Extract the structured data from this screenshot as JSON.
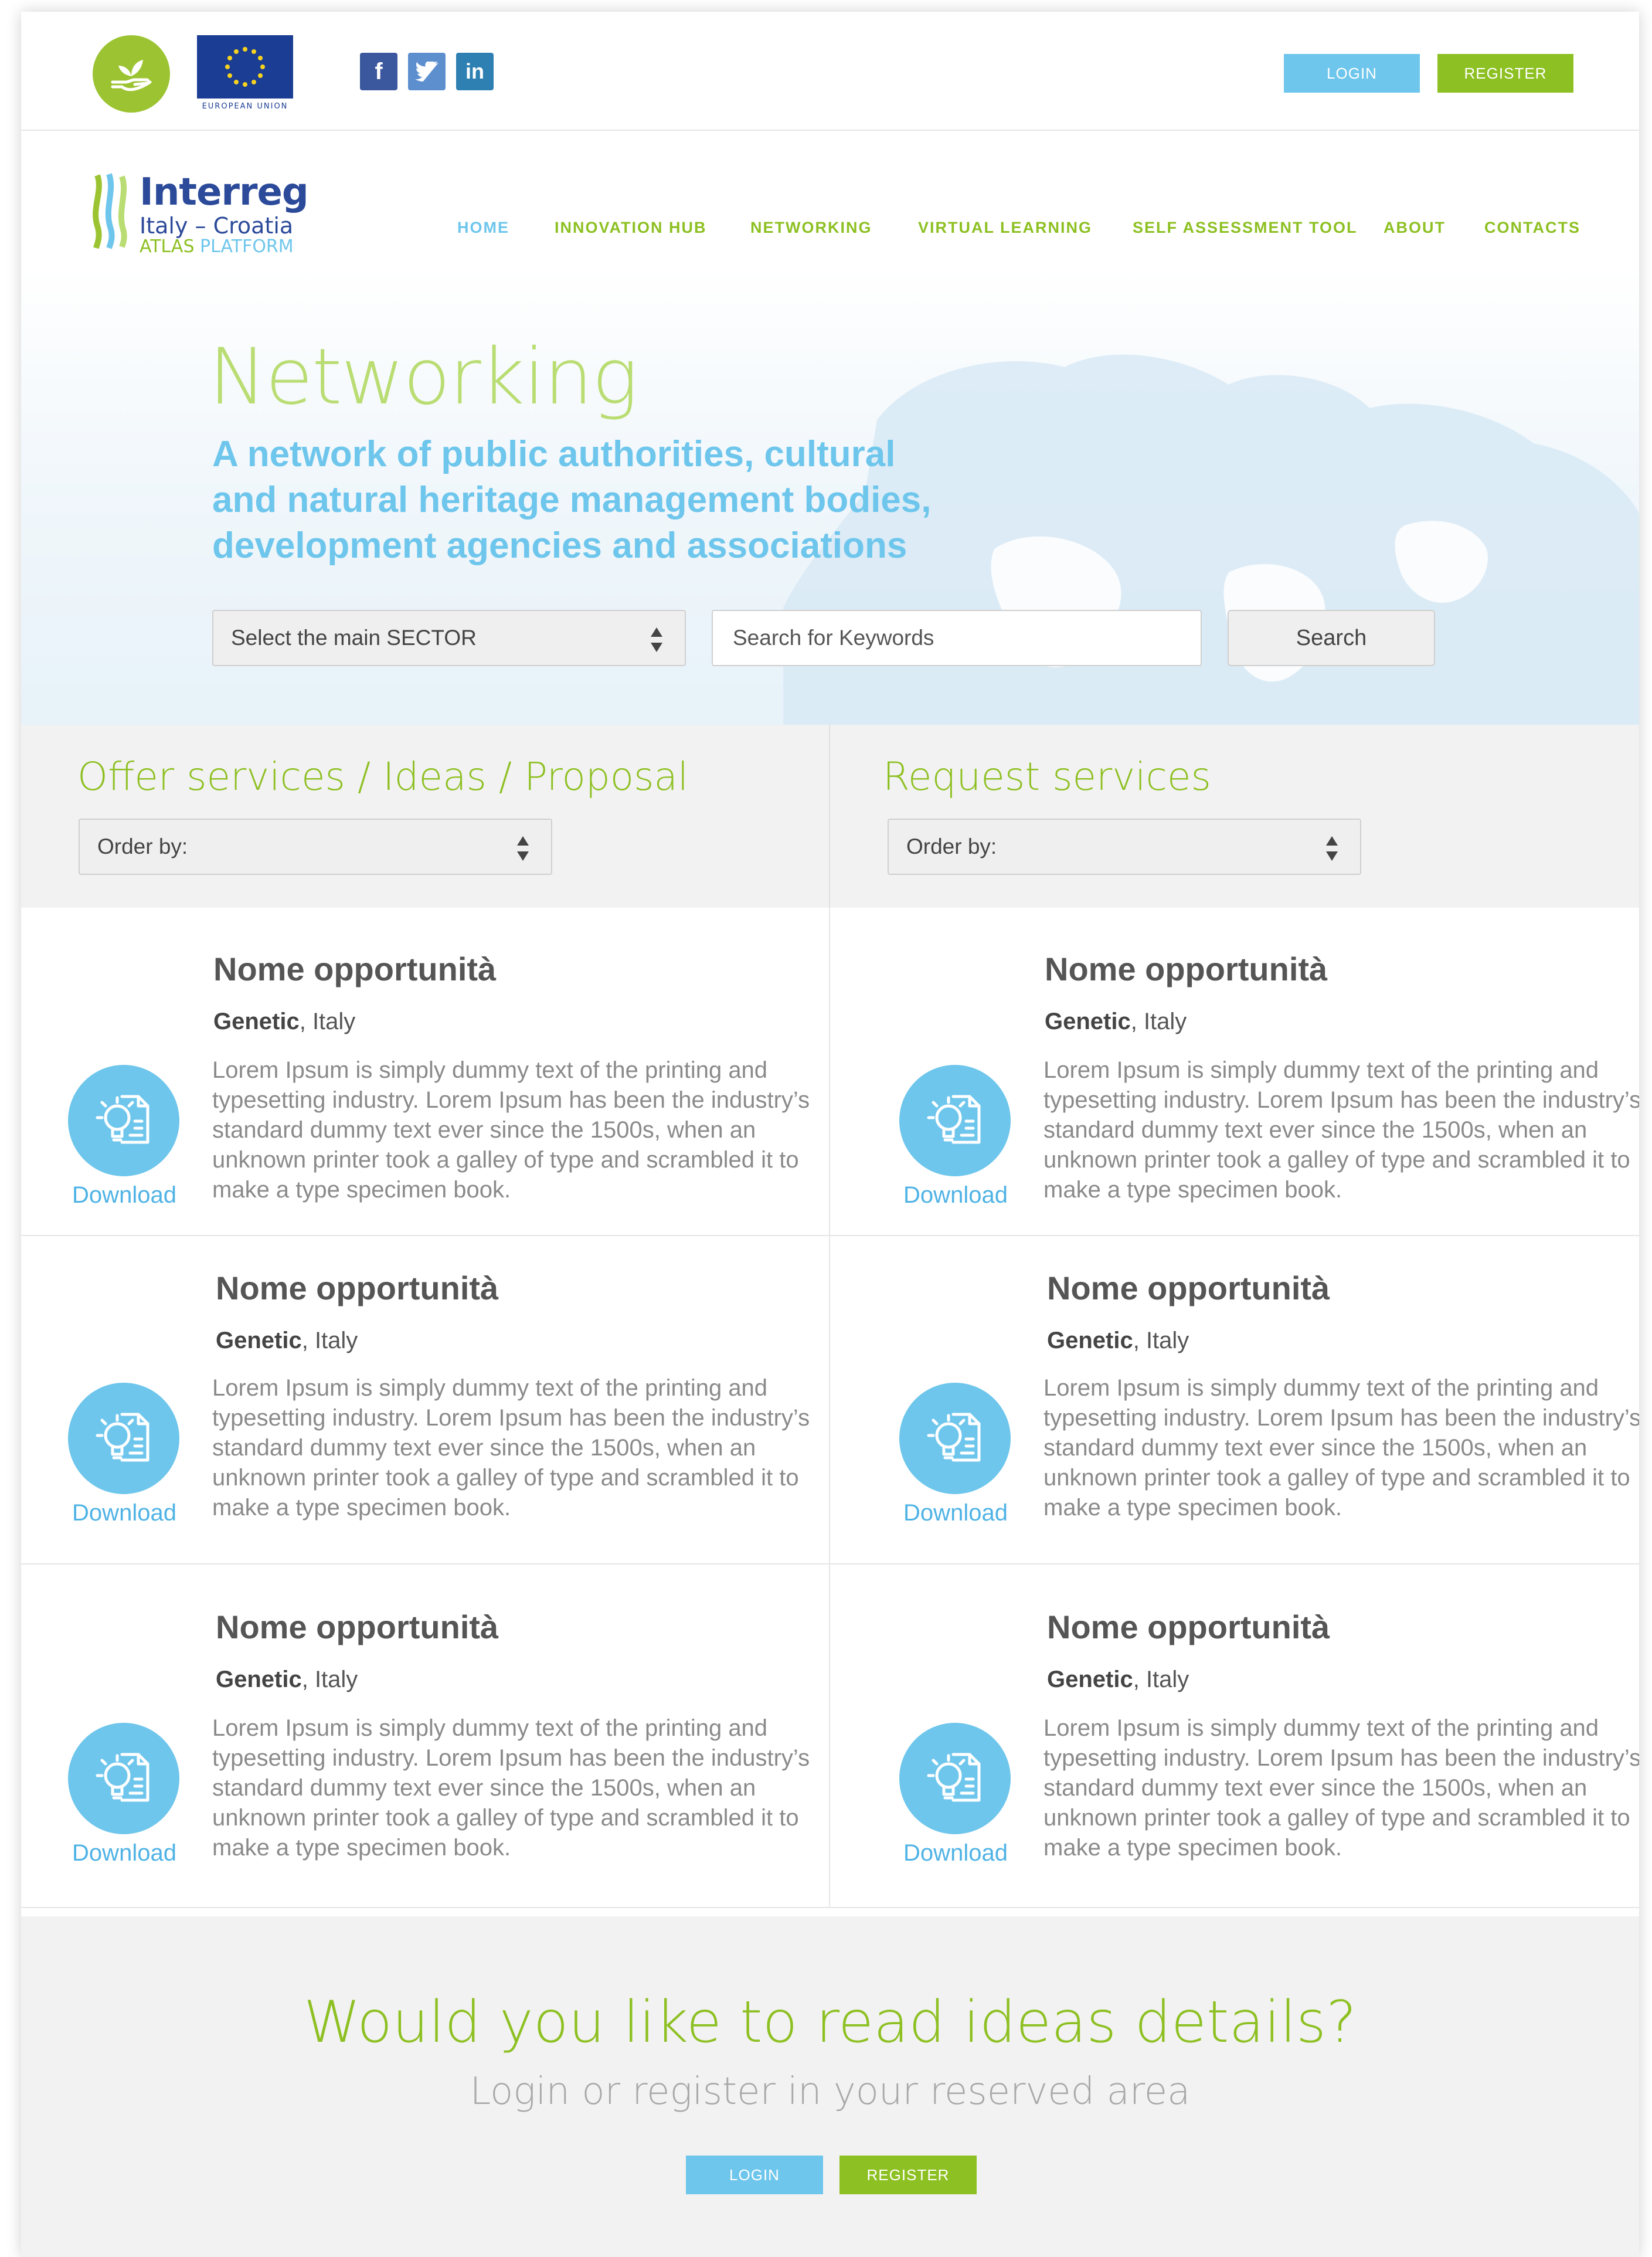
{
  "header": {
    "eu_label": "EUROPEAN UNION",
    "social": [
      "f",
      "t",
      "in"
    ],
    "login_label": "LOGIN",
    "register_label": "REGISTER"
  },
  "brand": {
    "title": "Interreg",
    "subtitle": "Italy – Croatia",
    "atlas": "ATLAS",
    "platform": "PLATFORM"
  },
  "nav": {
    "items": [
      {
        "label": "HOME",
        "active": true
      },
      {
        "label": "INNOVATION HUB",
        "active": false
      },
      {
        "label": "NETWORKING",
        "active": false
      },
      {
        "label": "VIRTUAL LEARNING",
        "active": false
      },
      {
        "label": "SELF ASSESSMENT TOOL",
        "active": false
      },
      {
        "label": "ABOUT",
        "active": false
      },
      {
        "label": "CONTACTS",
        "active": false
      }
    ]
  },
  "hero": {
    "title": "Networking",
    "subtitle_lines": [
      "A network of public authorities, cultural",
      "and natural heritage management bodies,",
      "development agencies and associations"
    ],
    "sector_select": "Select the main SECTOR",
    "keyword_placeholder": "Search for Keywords",
    "search_label": "Search"
  },
  "filters": {
    "offer_title": "Offer services / Ideas / Proposal",
    "request_title": "Request services",
    "order_label": "Order by:"
  },
  "cards": [
    {
      "title": "Nome opportunità",
      "sector": "Genetic",
      "country": ", Italy",
      "text": "Lorem Ipsum is simply dummy text of the printing and typesetting industry. Lorem Ipsum has been the industry’s standard dummy text ever since the 1500s, when an unknown printer took a galley of type and scrambled it to make a type specimen book.",
      "download": "Download"
    },
    {
      "title": "Nome opportunità",
      "sector": "Genetic",
      "country": ", Italy",
      "text": "Lorem Ipsum is simply dummy text of the printing and typesetting industry. Lorem Ipsum has been the industry’s standard dummy text ever since the 1500s, when an unknown printer took a galley of type and scrambled it to make a type specimen book.",
      "download": "Download"
    },
    {
      "title": "Nome opportunità",
      "sector": "Genetic",
      "country": ", Italy",
      "text": "Lorem Ipsum is simply dummy text of the printing and typesetting industry. Lorem Ipsum has been the industry’s standard dummy text ever since the 1500s, when an unknown printer took a galley of type and scrambled it to make a type specimen book.",
      "download": "Download"
    },
    {
      "title": "Nome opportunità",
      "sector": "Genetic",
      "country": ", Italy",
      "text": "Lorem Ipsum is simply dummy text of the printing and typesetting industry. Lorem Ipsum has been the industry’s standard dummy text ever since the 1500s, when an unknown printer took a galley of type and scrambled it to make a type specimen book.",
      "download": "Download"
    },
    {
      "title": "Nome opportunità",
      "sector": "Genetic",
      "country": ", Italy",
      "text": "Lorem Ipsum is simply dummy text of the printing and typesetting industry. Lorem Ipsum has been the industry’s standard dummy text ever since the 1500s, when an unknown printer took a galley of type and scrambled it to make a type specimen book.",
      "download": "Download"
    },
    {
      "title": "Nome opportunità",
      "sector": "Genetic",
      "country": ", Italy",
      "text": "Lorem Ipsum is simply dummy text of the printing and typesetting industry. Lorem Ipsum has been the industry’s standard dummy text ever since the 1500s, when an unknown printer took a galley of type and scrambled it to make a type specimen book.",
      "download": "Download"
    }
  ],
  "cta": {
    "title": "Would you like to read ideas details?",
    "subtitle": "Login or register in your reserved area",
    "login_label": "LOGIN",
    "register_label": "REGISTER"
  },
  "colors": {
    "green": "#8dc022",
    "blue": "#6ec6ec",
    "navy": "#2c4a9a"
  },
  "icons": {
    "top_logo": "hand-plant-icon",
    "eu_flag": "eu-stars-icon",
    "card_icon": "lightbulb-document-icon",
    "select_arrow": "up-down-arrows-icon"
  }
}
